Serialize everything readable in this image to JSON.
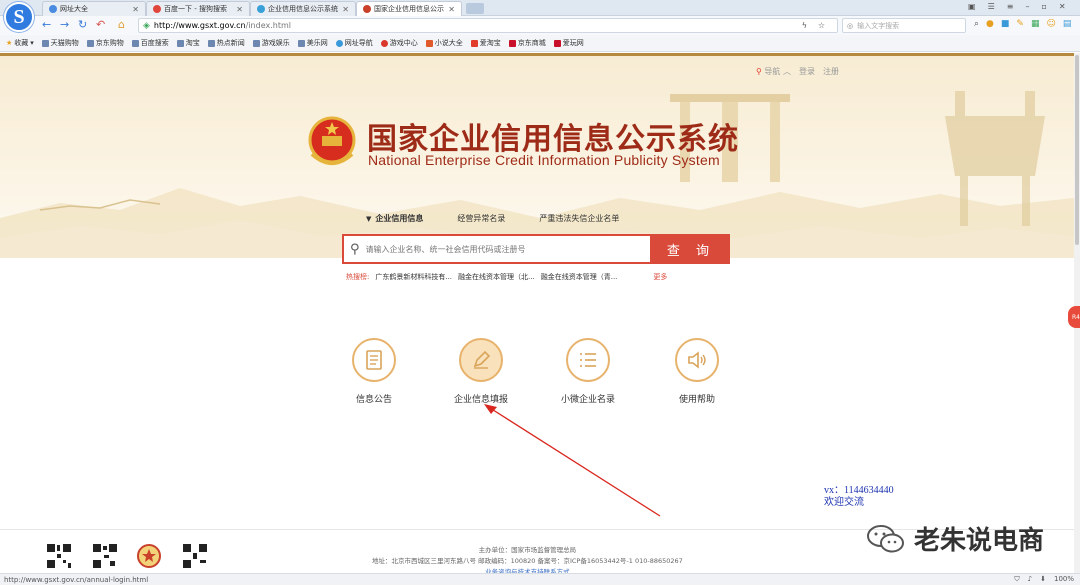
{
  "browser": {
    "tabs": [
      {
        "title": "网址大全",
        "active": false,
        "color": "#4a8be0"
      },
      {
        "title": "百度一下 - 搜狗搜索",
        "active": false,
        "color": "#e0463b"
      },
      {
        "title": "企业信用信息公示系统",
        "active": false,
        "color": "#3aa0d8"
      },
      {
        "title": "国家企业信用信息公示系",
        "active": true,
        "color": "#c9402b"
      }
    ],
    "url_domain": "http://www.gsxt.gov.cn",
    "url_path": "/index.html",
    "search_placeholder": "输入文字搜索",
    "bookmarks": [
      "收藏",
      "天猫购物",
      "京东购物",
      "百度搜索",
      "淘宝",
      "热点新闻",
      "游戏娱乐",
      "美乐网",
      "网址导航",
      "游戏中心",
      "小说大全",
      "爱淘宝",
      "京东商城",
      "爱玩网"
    ],
    "status_url": "http://www.gsxt.gov.cn/annual-login.html",
    "zoom": "100%"
  },
  "page": {
    "toplinks": {
      "nav": "导航",
      "login": "登录",
      "register": "注册"
    },
    "title_cn": "国家企业信用信息公示系统",
    "title_en": "National Enterprise Credit Information Publicity System",
    "categories": [
      "企业信用信息",
      "经营异常名录",
      "严重违法失信企业名单"
    ],
    "search": {
      "placeholder": "请输入企业名称、统一社会信用代码或注册号",
      "button": "查 询"
    },
    "hot": {
      "label": "热搜榜:",
      "items": [
        "广东鹤景新材料科技有...",
        "融金在线资本管理（北...",
        "融金在线资本管理（青..."
      ],
      "more": "更多"
    },
    "features": [
      {
        "label": "信息公告",
        "icon": "document-icon"
      },
      {
        "label": "企业信息填报",
        "icon": "pen-icon"
      },
      {
        "label": "小微企业名录",
        "icon": "list-icon"
      },
      {
        "label": "使用帮助",
        "icon": "speaker-icon"
      }
    ],
    "footer": {
      "sponsor": "主办单位：国家市场监督管理总局",
      "address": "地址：北京市西城区三里河东路八号   邮政编码：100820   备案号：京ICP备16053442号-1   010-88650267",
      "support": "业务咨询与技术支持联系方式"
    }
  },
  "overlay": {
    "vx": "vx：1144634440",
    "welcome": "欢迎交流",
    "watermark": "老朱说电商"
  },
  "side_badge": "R4"
}
